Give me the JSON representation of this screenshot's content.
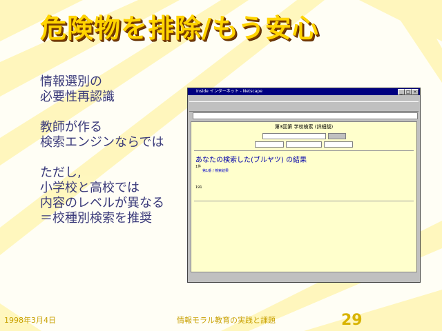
{
  "slide": {
    "title": "危険物を排除/もう安心",
    "bullets": [
      [
        "情報選別の",
        "必要性再認識"
      ],
      [
        "教師が作る",
        "検索エンジンならでは"
      ],
      [
        "ただし,",
        "小学校と高校では",
        "内容のレベルが異なる",
        "＝校種別検索を推奨"
      ]
    ],
    "footer": {
      "date": "1998年3月4日",
      "subject": "情報モラル教育の実践と課題",
      "page": "29"
    }
  },
  "screenshot": {
    "window_title": "Inside インターネット - Netscape",
    "page_title": "第3回第 学校検索 (詳細版)",
    "result_heading": "あなたの検索した(ブルヤツ) の結果",
    "result_count": "1件",
    "result_link": "第1番 / 検索結果",
    "result_number": "191"
  },
  "colors": {
    "title": "#ffd400",
    "bullet_text": "#3a3a7a",
    "footer": "#c8a000"
  }
}
